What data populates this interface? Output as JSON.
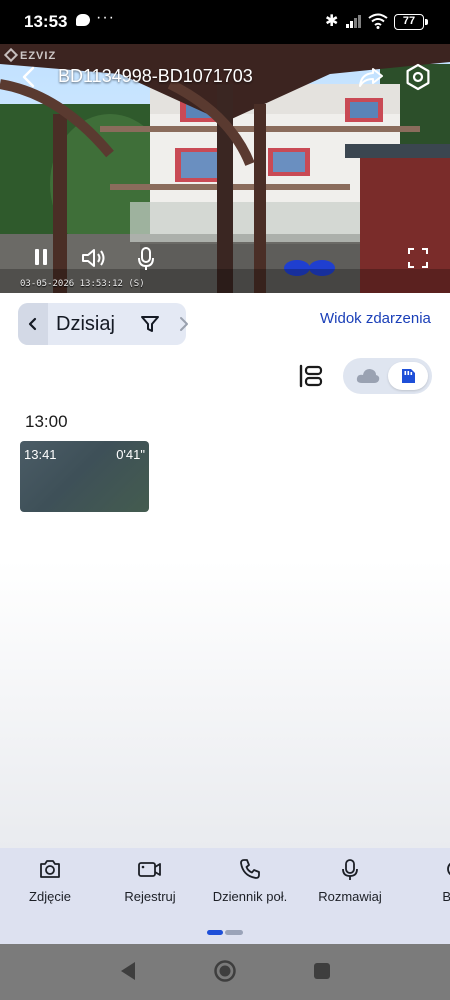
{
  "status_bar": {
    "time": "13:53",
    "dots": "···",
    "battery": "77"
  },
  "video": {
    "logo": "EZVIZ",
    "title": "BD1134998-BD1071703",
    "timestamp": "03-05-2026 13:53:12 (S)"
  },
  "date_bar": {
    "label": "Dzisiaj"
  },
  "event_view_link": "Widok zdarzenia",
  "timeline": {
    "hour_header": "13:00",
    "clips": [
      {
        "start": "13:41",
        "duration": "0'41\""
      }
    ]
  },
  "actions": [
    {
      "label": "Zdjęcie",
      "icon": "camera-icon"
    },
    {
      "label": "Rejestruj",
      "icon": "video-record-icon"
    },
    {
      "label": "Dziennik poł.",
      "icon": "phone-icon"
    },
    {
      "label": "Rozmawiaj",
      "icon": "microphone-icon"
    },
    {
      "label": "Blok",
      "icon": "lock-icon"
    }
  ],
  "colors": {
    "accent": "#1a3fb8",
    "pager_active": "#1e4fd8",
    "action_bar_bg": "#dde1f0"
  }
}
